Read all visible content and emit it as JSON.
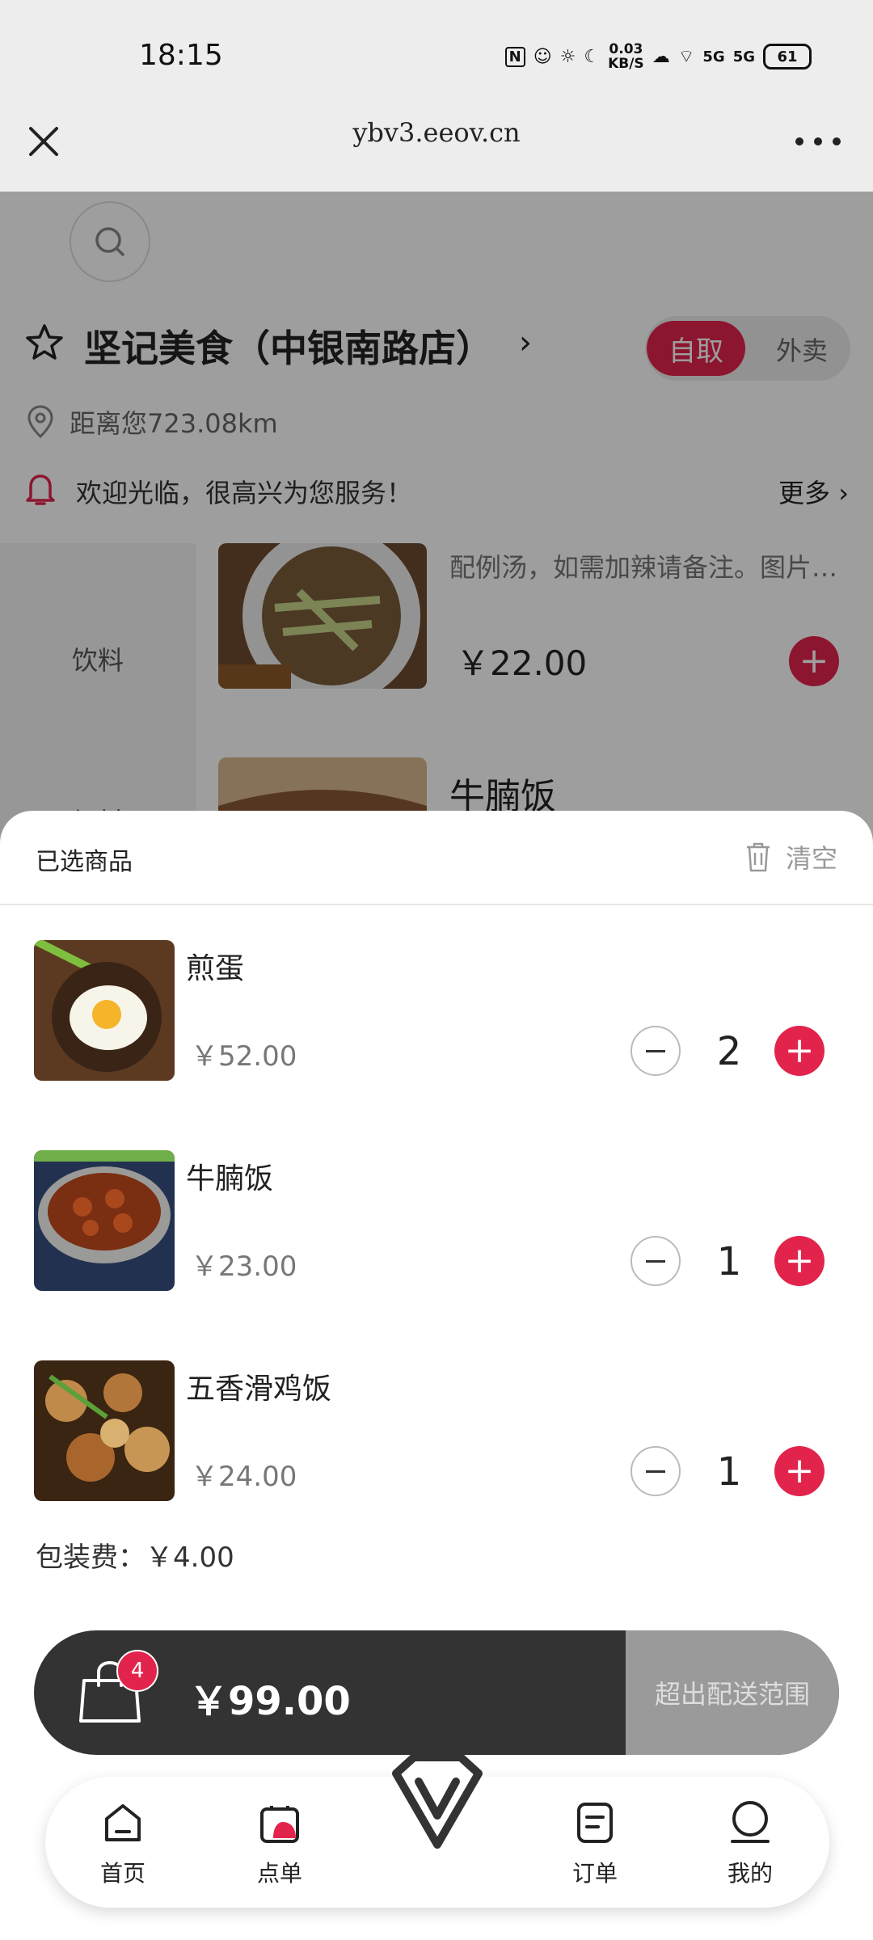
{
  "status_bar": {
    "time": "18:15",
    "net_speed_value": "0.03",
    "net_speed_unit": "KB/S",
    "signal1": "5G",
    "signal2": "5G",
    "battery": "61"
  },
  "browser": {
    "url": "ybv3.eeov.cn"
  },
  "store": {
    "name": "坚记美食（中银南路店）",
    "mode_pickup": "自取",
    "mode_delivery": "外卖",
    "distance": "距离您723.08km",
    "notice": "欢迎光临，很高兴为您服务！",
    "notice_more": "更多"
  },
  "menu": {
    "categories": [
      "饮料",
      "加料"
    ],
    "item_desc": "配例汤，如需加辣请备注。图片仅供参考",
    "item_price": "￥22.00",
    "next_item_name": "牛腩饭"
  },
  "cart": {
    "title": "已选商品",
    "clear_label": "清空",
    "items": [
      {
        "name": "煎蛋",
        "price": "￥52.00",
        "qty": "2"
      },
      {
        "name": "牛腩饭",
        "price": "￥23.00",
        "qty": "1"
      },
      {
        "name": "五香滑鸡饭",
        "price": "￥24.00",
        "qty": "1"
      }
    ],
    "packing_fee": "包装费：￥4.00",
    "badge_count": "4",
    "total": "￥99.00",
    "checkout_label": "超出配送范围"
  },
  "nav": {
    "home": "首页",
    "order": "点单",
    "orders": "订单",
    "mine": "我的"
  },
  "colors": {
    "accent": "#e2244c",
    "dark_bar": "#333333"
  }
}
